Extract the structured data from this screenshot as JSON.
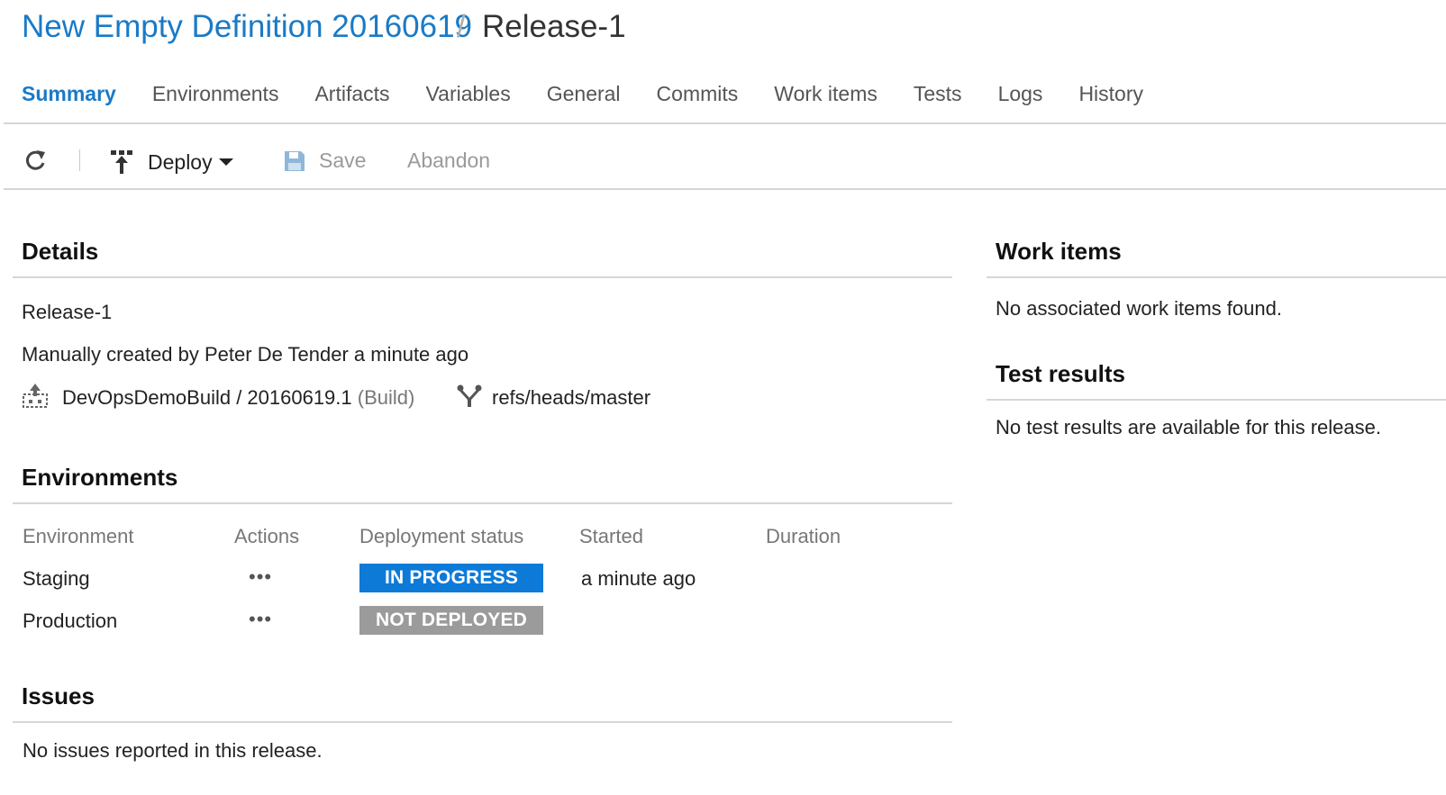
{
  "breadcrumb": {
    "definition": "New Empty Definition 20160619",
    "separator": "/",
    "release": "Release-1"
  },
  "tabs": [
    {
      "label": "Summary",
      "active": true
    },
    {
      "label": "Environments"
    },
    {
      "label": "Artifacts"
    },
    {
      "label": "Variables"
    },
    {
      "label": "General"
    },
    {
      "label": "Commits"
    },
    {
      "label": "Work items"
    },
    {
      "label": "Tests"
    },
    {
      "label": "Logs"
    },
    {
      "label": "History"
    }
  ],
  "toolbar": {
    "refresh_icon": "refresh-icon",
    "deploy_label": "Deploy",
    "deploy_icon": "deploy-icon",
    "save_label": "Save",
    "save_icon": "floppy-disk-icon",
    "abandon_label": "Abandon"
  },
  "details": {
    "heading": "Details",
    "release_name": "Release-1",
    "created_text": "Manually created by Peter De Tender a minute ago",
    "artifact": "DevOpsDemoBuild / 20160619.1",
    "artifact_type": "(Build)",
    "branch": "refs/heads/master"
  },
  "environments": {
    "heading": "Environments",
    "columns": [
      "Environment",
      "Actions",
      "Deployment status",
      "Started",
      "Duration"
    ],
    "rows": [
      {
        "name": "Staging",
        "actions": "•••",
        "status": "IN PROGRESS",
        "started": "a minute ago",
        "duration": ""
      },
      {
        "name": "Production",
        "actions": "•••",
        "status": "NOT DEPLOYED",
        "started": "",
        "duration": ""
      }
    ]
  },
  "issues": {
    "heading": "Issues",
    "text": "No issues reported in this release."
  },
  "work_items": {
    "heading": "Work items",
    "text": "No associated work items found."
  },
  "test_results": {
    "heading": "Test results",
    "text": "No test results are available for this release."
  },
  "colors": {
    "accent": "#1a7ac6",
    "in_progress": "#0e7ad8",
    "not_deployed": "#9b9b9b"
  }
}
